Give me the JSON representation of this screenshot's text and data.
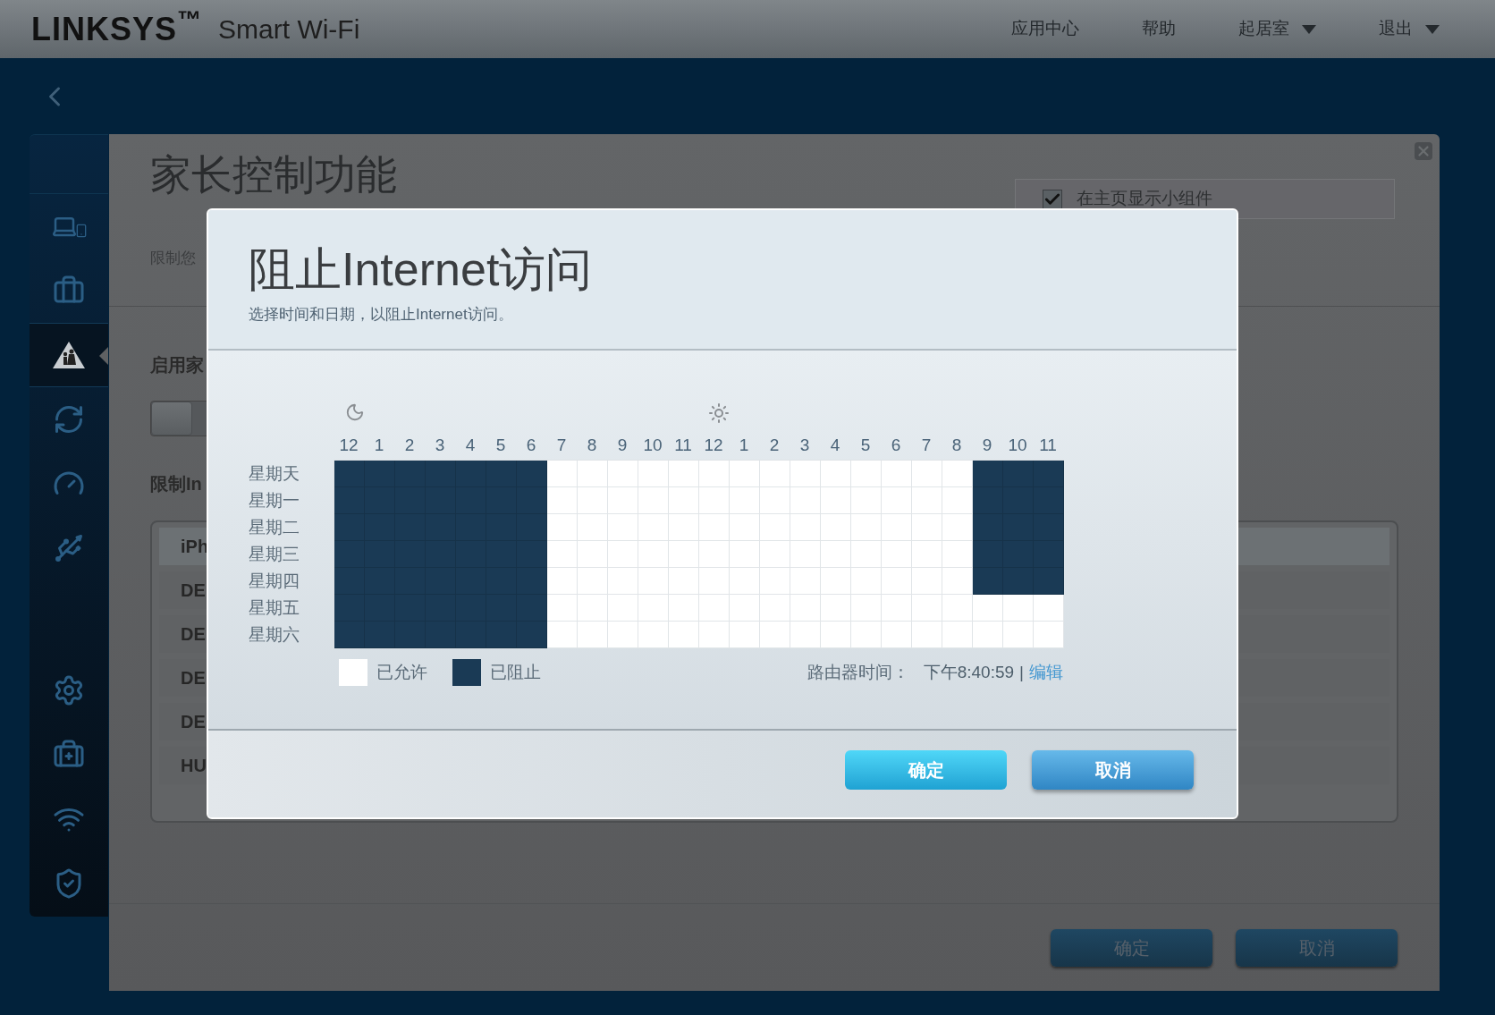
{
  "header": {
    "logo": "LINKSYS$^{™}$",
    "product": "Smart Wi-Fi",
    "nav": [
      {
        "label": "应用中心",
        "dropdown": false
      },
      {
        "label": "帮助",
        "dropdown": false
      },
      {
        "label": "起居室",
        "dropdown": true
      },
      {
        "label": "退出",
        "dropdown": true
      }
    ]
  },
  "sidebar": {
    "items": [
      {
        "selected": false
      },
      {
        "selected": false
      },
      {
        "selected": true
      },
      {
        "selected": false
      },
      {
        "selected": false
      },
      {
        "selected": false
      },
      {
        "selected": false
      },
      {
        "selected": false
      },
      {
        "selected": false
      },
      {
        "selected": false
      }
    ]
  },
  "page": {
    "title": "家长控制功能",
    "subtitle": "限制您",
    "widget_checkbox": {
      "label": "在主页显示小组件",
      "checked": true
    },
    "enable_label": "启用家",
    "toggle": {
      "on": false
    },
    "restrict_label": "限制In",
    "devices": [
      {
        "name": "iPh",
        "selected": true
      },
      {
        "name": "DE",
        "selected": false
      },
      {
        "name": "DE",
        "selected": false
      },
      {
        "name": "DE",
        "selected": false
      },
      {
        "name": "DE",
        "selected": false
      },
      {
        "name": "HU",
        "selected": false
      }
    ],
    "buttons": [
      "确定",
      "取消"
    ]
  },
  "dialog": {
    "title": "阻止Internet访问",
    "subtitle": "选择时间和日期，以阻止Internet访问。",
    "hours": [
      "12",
      "1",
      "2",
      "3",
      "4",
      "5",
      "6",
      "7",
      "8",
      "9",
      "10",
      "11",
      "12",
      "1",
      "2",
      "3",
      "4",
      "5",
      "6",
      "7",
      "8",
      "9",
      "10",
      "11"
    ],
    "days": [
      {
        "label": "星期天",
        "blocked": [
          true,
          true,
          true,
          true,
          true,
          true,
          true,
          false,
          false,
          false,
          false,
          false,
          false,
          false,
          false,
          false,
          false,
          false,
          false,
          false,
          false,
          true,
          true,
          true
        ]
      },
      {
        "label": "星期一",
        "blocked": [
          true,
          true,
          true,
          true,
          true,
          true,
          true,
          false,
          false,
          false,
          false,
          false,
          false,
          false,
          false,
          false,
          false,
          false,
          false,
          false,
          false,
          true,
          true,
          true
        ]
      },
      {
        "label": "星期二",
        "blocked": [
          true,
          true,
          true,
          true,
          true,
          true,
          true,
          false,
          false,
          false,
          false,
          false,
          false,
          false,
          false,
          false,
          false,
          false,
          false,
          false,
          false,
          true,
          true,
          true
        ]
      },
      {
        "label": "星期三",
        "blocked": [
          true,
          true,
          true,
          true,
          true,
          true,
          true,
          false,
          false,
          false,
          false,
          false,
          false,
          false,
          false,
          false,
          false,
          false,
          false,
          false,
          false,
          true,
          true,
          true
        ]
      },
      {
        "label": "星期四",
        "blocked": [
          true,
          true,
          true,
          true,
          true,
          true,
          true,
          false,
          false,
          false,
          false,
          false,
          false,
          false,
          false,
          false,
          false,
          false,
          false,
          false,
          false,
          true,
          true,
          true
        ]
      },
      {
        "label": "星期五",
        "blocked": [
          true,
          true,
          true,
          true,
          true,
          true,
          true,
          false,
          false,
          false,
          false,
          false,
          false,
          false,
          false,
          false,
          false,
          false,
          false,
          false,
          false,
          false,
          false,
          false
        ]
      },
      {
        "label": "星期六",
        "blocked": [
          true,
          true,
          true,
          true,
          true,
          true,
          true,
          false,
          false,
          false,
          false,
          false,
          false,
          false,
          false,
          false,
          false,
          false,
          false,
          false,
          false,
          false,
          false,
          false
        ]
      }
    ],
    "legend": [
      {
        "label": "已允许",
        "kind": "allowed"
      },
      {
        "label": "已阻止",
        "kind": "blocked"
      }
    ],
    "router_time_label": "路由器时间：",
    "router_time": "下午8:40:59",
    "separator": "|",
    "edit_link": "编辑",
    "buttons": [
      {
        "label": "确定",
        "kind": "primary"
      },
      {
        "label": "取消",
        "kind": "secondary"
      }
    ]
  }
}
